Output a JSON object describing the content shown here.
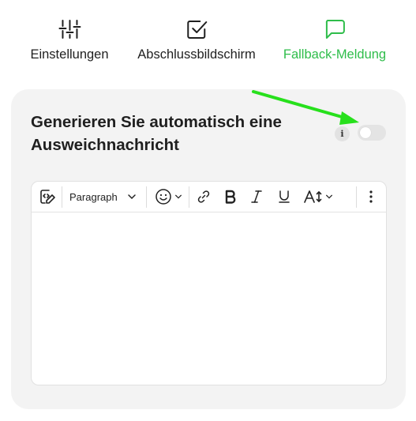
{
  "tabs": [
    {
      "label": "Einstellungen",
      "icon": "sliders-icon",
      "active": false
    },
    {
      "label": "Abschlussbildschirm",
      "icon": "checkbox-icon",
      "active": false
    },
    {
      "label": "Fallback-Meldung",
      "icon": "message-icon",
      "active": true
    }
  ],
  "card": {
    "title": "Generieren Sie automatisch eine Ausweichnachricht",
    "info_glyph": "i",
    "toggle_on": false
  },
  "editor": {
    "block_style": "Paragraph",
    "content": ""
  },
  "colors": {
    "accent": "#2ebd4a",
    "card_bg": "#f3f3f3",
    "annotation_arrow": "#27e01c"
  }
}
